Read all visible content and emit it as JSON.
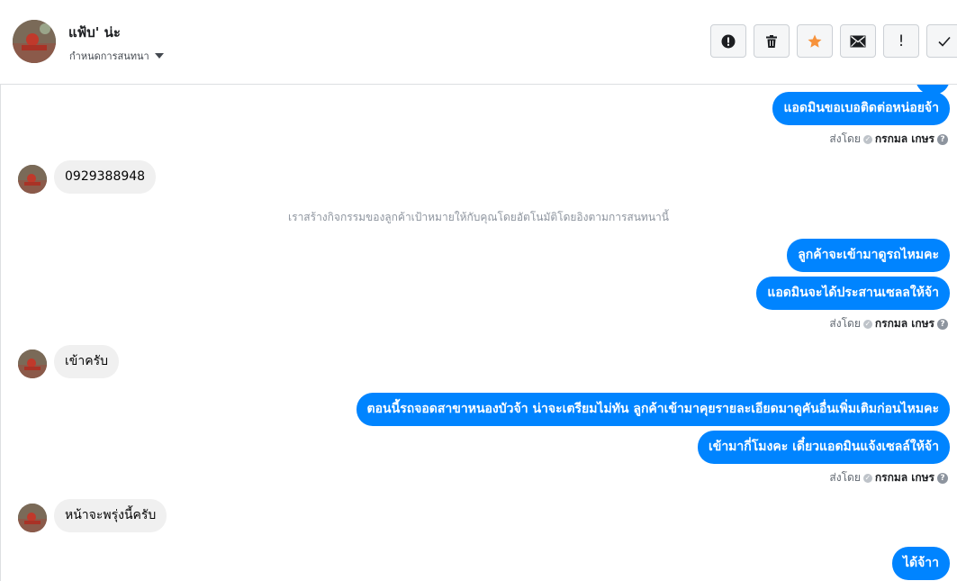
{
  "header": {
    "contact_name": "แฟ้บ' น่ะ",
    "settings_label": "กำหนดการสนทนา"
  },
  "toolbar": {
    "buttons": [
      {
        "name": "report-spam-button",
        "icon": "alert-circle-icon"
      },
      {
        "name": "delete-button",
        "icon": "trash-icon"
      },
      {
        "name": "star-button",
        "icon": "star-icon",
        "color": "#f7923b"
      },
      {
        "name": "mark-unread-button",
        "icon": "envelope-icon"
      },
      {
        "name": "follow-up-button",
        "icon": "exclamation-icon",
        "glyph": "!"
      },
      {
        "name": "mark-done-button",
        "icon": "checkmark-icon"
      }
    ]
  },
  "colors": {
    "outgoing_bubble": "#0084ff",
    "incoming_bubble": "#f0f0f0",
    "accent_star": "#f7923b"
  },
  "messages": {
    "out_1": "แอดมินขอเบอติดต่อหน่อยจ้า",
    "sent_by_1": {
      "prefix": "ส่งโดย",
      "name": "กรกมล เกษร"
    },
    "in_1": "0929388948",
    "system_note": "เราสร้างกิจกรรมของลูกค้าเป้าหมายให้กับคุณโดยอัตโนมัติโดยอิงตามการสนทนานี้",
    "out_2": "ลูกค้าจะเข้ามาดูรถไหมคะ",
    "out_3": "แอดมินจะได้ประสานเซลลให้จ้า",
    "sent_by_2": {
      "prefix": "ส่งโดย",
      "name": "กรกมล เกษร"
    },
    "in_2": "เข้าครับ",
    "out_4": "ตอนนี้รถจอดสาขาหนองบัวจ้า น่าจะเตรียมไม่ทัน ลูกค้าเข้ามาคุยรายละเอียดมาดูคันอื่นเพิ่มเติมก่อนไหมคะ",
    "out_5": "เข้ามากี่โมงคะ เดี๋ยวแอดมินแจ้งเซลล์ให้จ้า",
    "sent_by_3": {
      "prefix": "ส่งโดย",
      "name": "กรกมล เกษร"
    },
    "in_3": "หน้าจะพรุ่งนี้ครับ",
    "out_6": "ได้จ้าา"
  }
}
